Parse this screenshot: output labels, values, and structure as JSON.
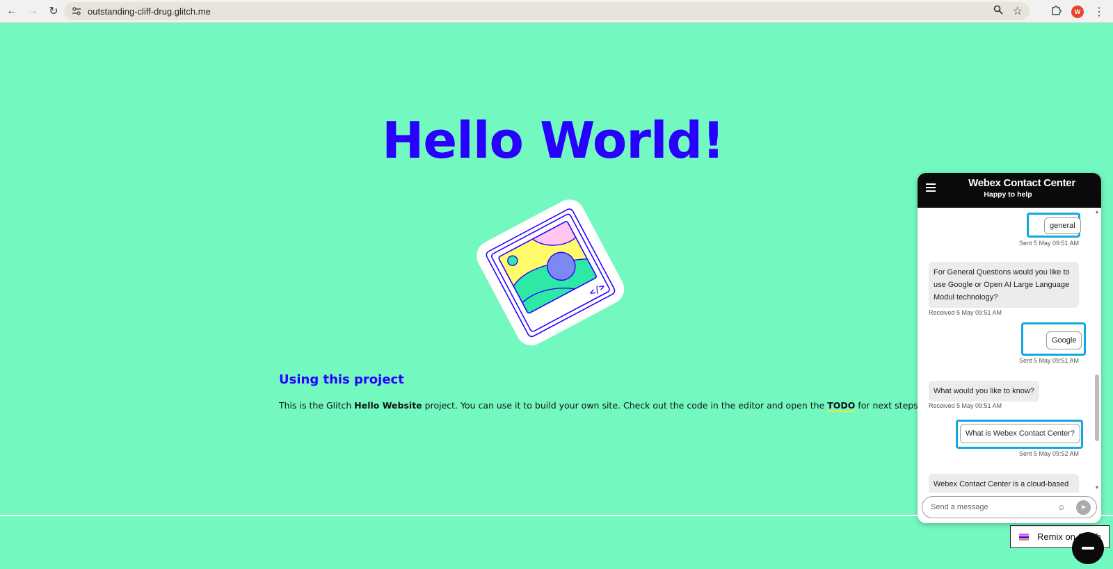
{
  "browser": {
    "url": "outstanding-cliff-drug.glitch.me",
    "avatar_letter": "W"
  },
  "page": {
    "title": "Hello World!",
    "section_heading": "Using this project",
    "body": {
      "p1": "This is the Glitch ",
      "b1": "Hello Website",
      "p2": " project. You can use it to build your own site. Check out the code in the editor and open the ",
      "todo": "TODO",
      "p3": " for next steps!"
    },
    "remix_label": "Remix on Glitch"
  },
  "chat": {
    "title": "Webex Contact Center",
    "subtitle": "Happy to help",
    "messages": [
      {
        "type": "sent",
        "text": "general",
        "meta": "Sent  5 May 09:51 AM"
      },
      {
        "type": "received",
        "text": "For General Questions would you like to use Google or Open AI Large Language Modul technology?",
        "meta": "Received  5 May 09:51 AM"
      },
      {
        "type": "sent",
        "text": "Google",
        "meta": "Sent  5 May 09:51 AM"
      },
      {
        "type": "received",
        "text": "What would you like to know?",
        "meta": "Received  5 May 09:51 AM"
      },
      {
        "type": "sent",
        "text": "What is Webex Contact Center?",
        "meta": "Sent  5 May 09:52 AM"
      },
      {
        "type": "received",
        "text": "Webex Contact Center is a cloud-based customer experience platform that",
        "meta": ""
      }
    ],
    "input_placeholder": "Send a message"
  },
  "colors": {
    "background": "#73f8c0",
    "title": "#2800ff",
    "highlight": "#0fa8e0",
    "chat_header": "#0a0a0a"
  }
}
